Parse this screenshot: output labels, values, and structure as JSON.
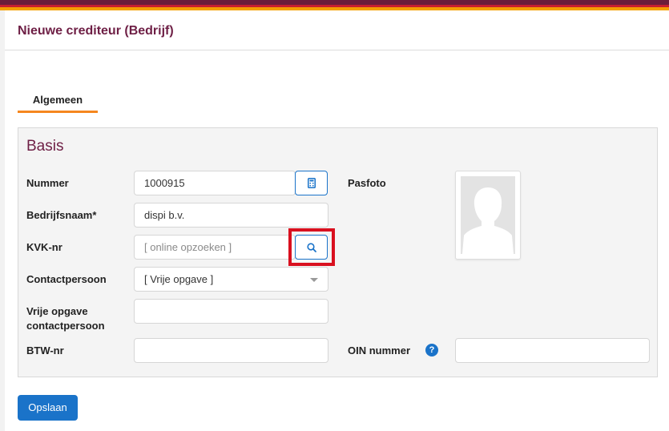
{
  "brand": {
    "accent": "#6e1f45",
    "primary_button": "#1a73c9",
    "tab_underline": "#f5871f",
    "highlight": "#d9101f"
  },
  "header": {
    "title": "Nieuwe crediteur (Bedrijf)"
  },
  "tabs": [
    {
      "label": "Algemeen",
      "active": true
    }
  ],
  "section": {
    "title": "Basis"
  },
  "form": {
    "nummer": {
      "label": "Nummer",
      "value": "1000915",
      "button_icon": "calculator-icon"
    },
    "bedrijfsnaam": {
      "label": "Bedrijfsnaam*",
      "value": "dispi b.v."
    },
    "kvk": {
      "label": "KVK-nr",
      "placeholder": "[ online opzoeken ]",
      "button_icon": "search-icon"
    },
    "contactpersoon": {
      "label": "Contactpersoon",
      "selected": "[ Vrije opgave ]"
    },
    "vrije_opgave": {
      "label_line1": "Vrije opgave",
      "label_line2": "contactpersoon",
      "value": ""
    },
    "btw": {
      "label": "BTW-nr",
      "value": ""
    },
    "pasfoto": {
      "label": "Pasfoto",
      "icon": "person-silhouette-icon"
    },
    "oin": {
      "label": "OIN nummer",
      "help": "?",
      "value": ""
    }
  },
  "actions": {
    "save_label": "Opslaan"
  }
}
